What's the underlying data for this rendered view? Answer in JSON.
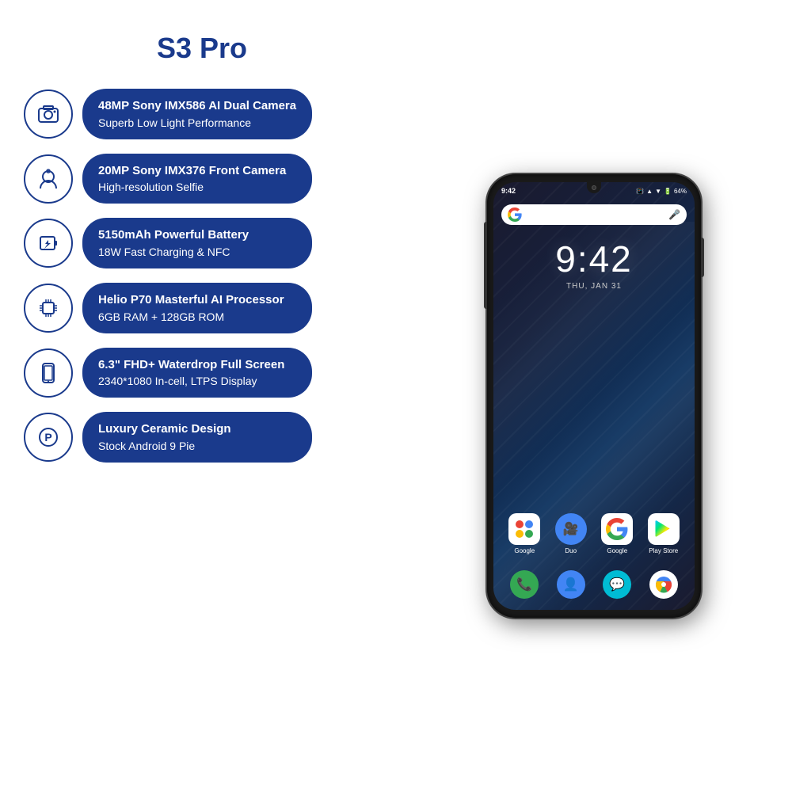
{
  "title": "S3 Pro",
  "features": [
    {
      "id": "camera",
      "icon": "📷",
      "line1": "48MP Sony IMX586 AI Dual Camera",
      "line2": "Superb Low Light Performance"
    },
    {
      "id": "selfie",
      "icon": "🤳",
      "line1": "20MP Sony IMX376 Front Camera",
      "line2": "High-resolution Selfie"
    },
    {
      "id": "battery",
      "icon": "⚡",
      "line1": "5150mAh Powerful Battery",
      "line2": "18W Fast Charging & NFC"
    },
    {
      "id": "processor",
      "icon": "🔲",
      "line1": "Helio P70 Masterful AI Processor",
      "line2": "6GB RAM + 128GB ROM"
    },
    {
      "id": "display",
      "icon": "📱",
      "line1": "6.3\" FHD+ Waterdrop Full Screen",
      "line2": "2340*1080 In-cell, LTPS Display"
    },
    {
      "id": "android",
      "icon": "Ⓟ",
      "line1": "Luxury Ceramic Design",
      "line2": "Stock Android 9 Pie"
    }
  ],
  "phone": {
    "status_time": "9:42",
    "status_battery": "64%",
    "clock_time": "9:42",
    "clock_date": "THU, JAN 31",
    "apps": [
      {
        "label": "Google",
        "color": "#fff"
      },
      {
        "label": "Duo",
        "color": "#4285f4"
      },
      {
        "label": "Google",
        "color": "#fff"
      },
      {
        "label": "Play Store",
        "color": "#fff"
      }
    ],
    "dock": [
      {
        "label": "Phone",
        "color": "#34a853"
      },
      {
        "label": "Contacts",
        "color": "#4285f4"
      },
      {
        "label": "Messages",
        "color": "#00bcd4"
      },
      {
        "label": "Chrome",
        "color": "#fff"
      }
    ]
  }
}
